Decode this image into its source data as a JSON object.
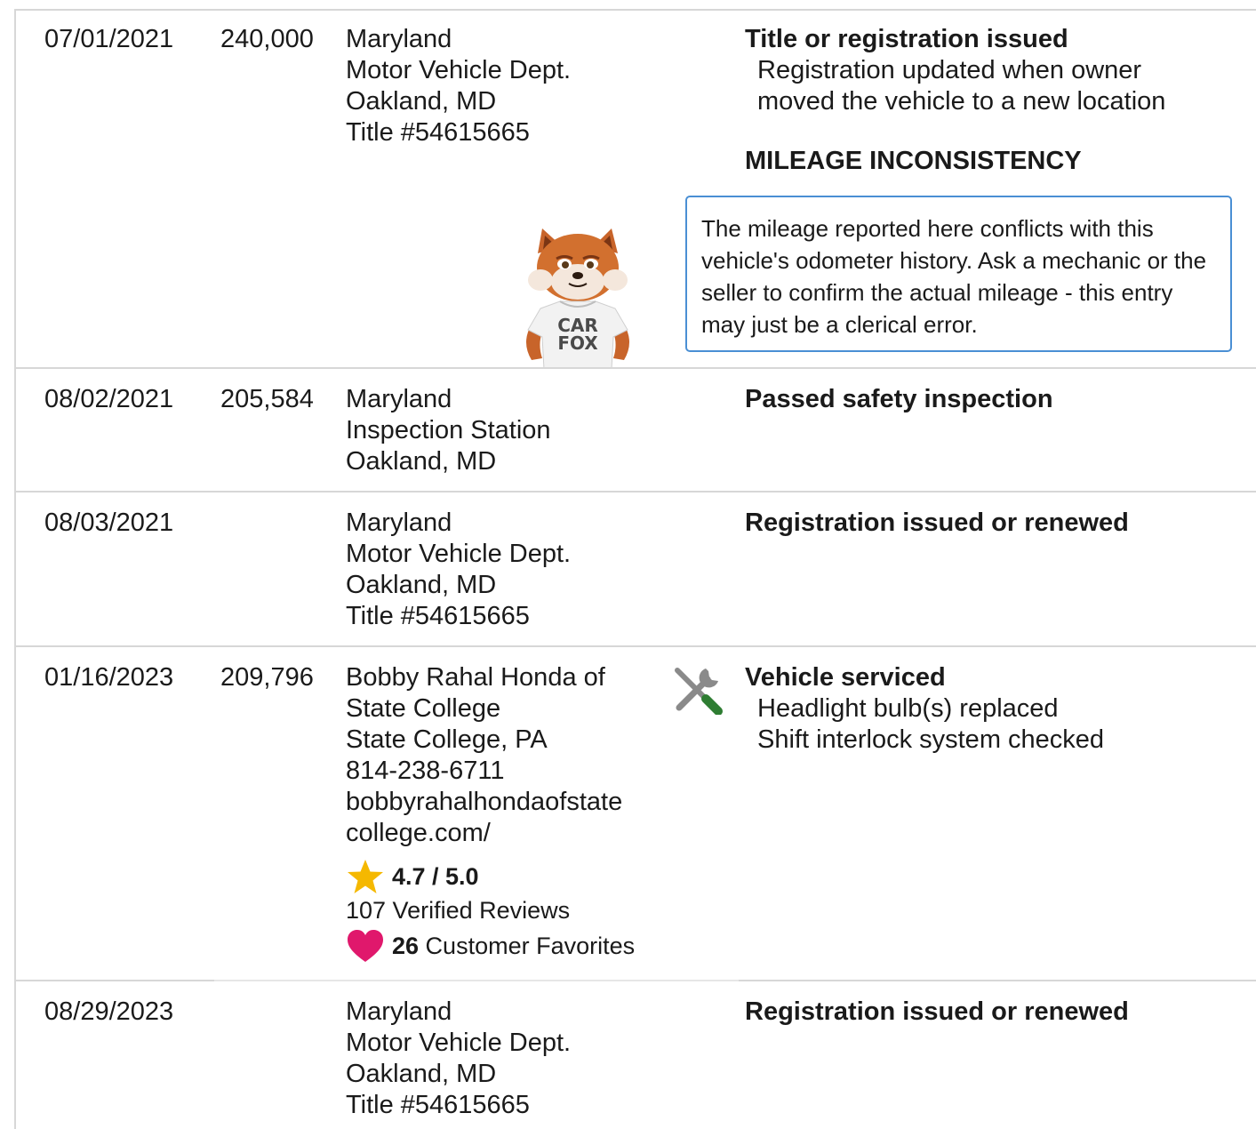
{
  "rows": [
    {
      "date": "07/01/2021",
      "odometer": "240,000",
      "source": [
        "Maryland",
        "Motor Vehicle Dept.",
        "Oakland, MD",
        "Title #54615665"
      ],
      "heading": "Title or registration issued",
      "details": [
        "Registration updated when owner",
        "moved the vehicle to a new location"
      ],
      "warning_title": "MILEAGE INCONSISTENCY",
      "warning_text": "The mileage reported here conflicts with this vehicle's odometer history. Ask a mechanic or the seller to confirm the actual mileage - this entry may just be a clerical error.",
      "mascot_text": [
        "CAR",
        "FOX"
      ]
    },
    {
      "date": "08/02/2021",
      "odometer": "205,584",
      "source": [
        "Maryland",
        "Inspection Station",
        "Oakland, MD"
      ],
      "heading": "Passed safety inspection"
    },
    {
      "date": "08/03/2021",
      "odometer": "",
      "source": [
        "Maryland",
        "Motor Vehicle Dept.",
        "Oakland, MD",
        "Title #54615665"
      ],
      "heading": "Registration issued or renewed"
    },
    {
      "date": "01/16/2023",
      "odometer": "209,796",
      "source": [
        "Bobby Rahal Honda of",
        "State College",
        "State College, PA",
        "814-238-6711",
        "bobbyrahalhondaofstate",
        "college.com/"
      ],
      "heading": "Vehicle serviced",
      "details": [
        "Headlight bulb(s) replaced",
        "Shift interlock system checked"
      ],
      "rating": "4.7 / 5.0",
      "reviews": "107 Verified Reviews",
      "favorites_count": "26",
      "favorites_label": " Customer Favorites"
    },
    {
      "date": "08/29/2023",
      "odometer": "",
      "source": [
        "Maryland",
        "Motor Vehicle Dept.",
        "Oakland, MD",
        "Title #54615665"
      ],
      "heading": "Registration issued or renewed"
    }
  ],
  "colors": {
    "divider": "#d7d7d7",
    "warning_border": "#4a8fd4",
    "star": "#f5b800",
    "heart": "#e0186c",
    "wrench_gray": "#8a8a8a",
    "wrench_green": "#2e7d32"
  },
  "icons": [
    "car-fox-mascot",
    "service-wrench-icon",
    "star-icon",
    "heart-icon"
  ]
}
